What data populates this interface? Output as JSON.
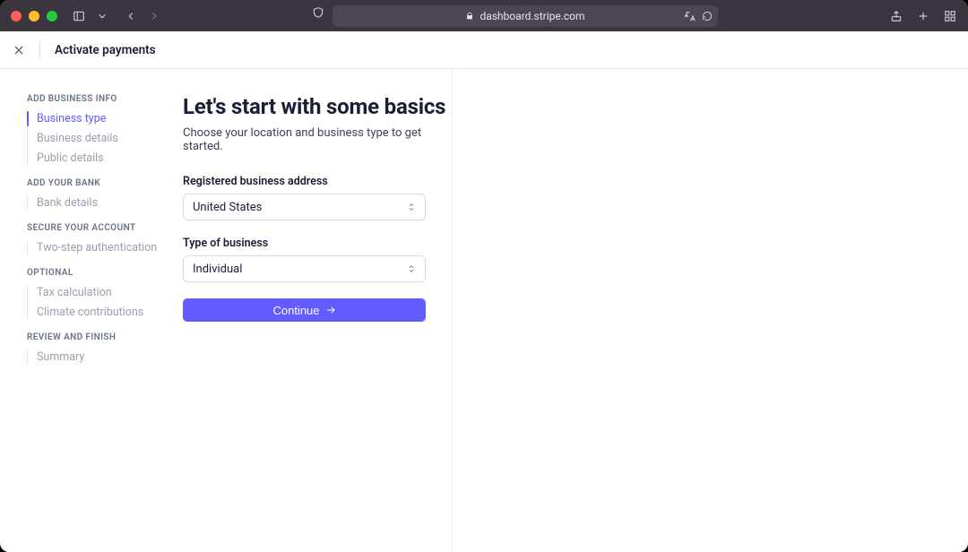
{
  "browser": {
    "url": "dashboard.stripe.com"
  },
  "header": {
    "title": "Activate payments"
  },
  "sidebar": {
    "sections": [
      {
        "title": "ADD BUSINESS INFO",
        "items": [
          "Business type",
          "Business details",
          "Public details"
        ]
      },
      {
        "title": "ADD YOUR BANK",
        "items": [
          "Bank details"
        ]
      },
      {
        "title": "SECURE YOUR ACCOUNT",
        "items": [
          "Two-step authentication"
        ]
      },
      {
        "title": "OPTIONAL",
        "items": [
          "Tax calculation",
          "Climate contributions"
        ]
      },
      {
        "title": "REVIEW AND FINISH",
        "items": [
          "Summary"
        ]
      }
    ]
  },
  "main": {
    "title": "Let's start with some basics",
    "subtitle": "Choose your location and business type to get started.",
    "address_label": "Registered business address",
    "address_value": "United States",
    "type_label": "Type of business",
    "type_value": "Individual",
    "cta_label": "Continue"
  }
}
